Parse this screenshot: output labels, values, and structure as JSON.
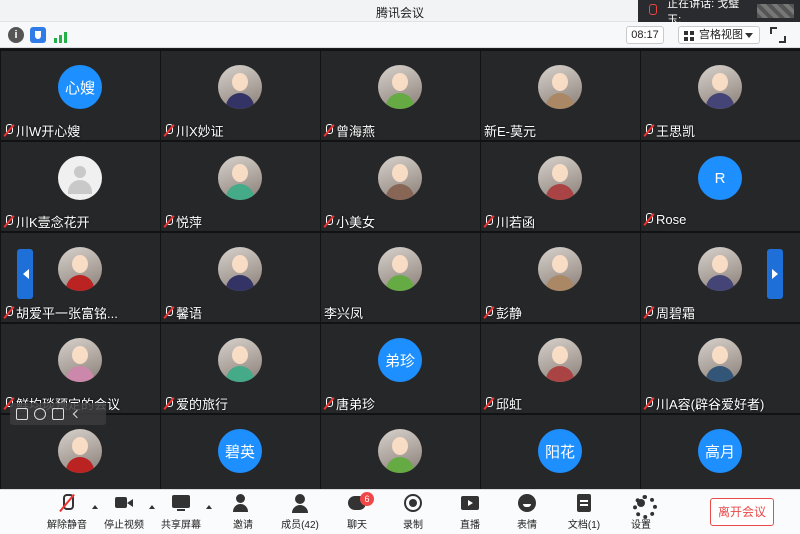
{
  "window": {
    "title": "腾讯会议",
    "speaking_label": "正在讲话: 戈璧玉;"
  },
  "infobar": {
    "time": "08:17",
    "view_label": "宫格视图"
  },
  "participants": [
    {
      "name": "川W开心嫂",
      "avatar_text": "心嫂",
      "muted": true
    },
    {
      "name": "川X妙证",
      "avatar_text": "",
      "muted": true
    },
    {
      "name": "曾海燕",
      "avatar_text": "",
      "muted": true
    },
    {
      "name": "新E-莫元",
      "avatar_text": "",
      "muted": false
    },
    {
      "name": "王思凯",
      "avatar_text": "",
      "muted": true
    },
    {
      "name": "川K壹念花开",
      "avatar_text": "",
      "muted": true
    },
    {
      "name": "悦萍",
      "avatar_text": "",
      "muted": true
    },
    {
      "name": "小美女",
      "avatar_text": "",
      "muted": true
    },
    {
      "name": "川若函",
      "avatar_text": "",
      "muted": true
    },
    {
      "name": "Rose",
      "avatar_text": "R",
      "muted": true
    },
    {
      "name": "胡爱平一张富铭...",
      "avatar_text": "",
      "muted": true
    },
    {
      "name": "馨语",
      "avatar_text": "",
      "muted": true
    },
    {
      "name": "李兴凤",
      "avatar_text": "",
      "muted": false
    },
    {
      "name": "彭静",
      "avatar_text": "",
      "muted": true
    },
    {
      "name": "周碧霜",
      "avatar_text": "",
      "muted": true
    },
    {
      "name": "鲜均琰预定的会议",
      "avatar_text": "",
      "muted": true
    },
    {
      "name": "爱的旅行",
      "avatar_text": "",
      "muted": true
    },
    {
      "name": "唐弟珍",
      "avatar_text": "弟珍",
      "muted": true
    },
    {
      "name": "邱虹",
      "avatar_text": "",
      "muted": true
    },
    {
      "name": "川A容(辟谷爱好者)",
      "avatar_text": "",
      "muted": true
    },
    {
      "name": "",
      "avatar_text": "",
      "muted": false
    },
    {
      "name": "",
      "avatar_text": "碧英",
      "muted": false
    },
    {
      "name": "",
      "avatar_text": "",
      "muted": false
    },
    {
      "name": "",
      "avatar_text": "阳花",
      "muted": false
    },
    {
      "name": "",
      "avatar_text": "高月",
      "muted": false
    }
  ],
  "toolbar": {
    "unmute": "解除静音",
    "stop_video": "停止视频",
    "share_screen": "共享屏幕",
    "invite": "邀请",
    "members": "成员(42)",
    "chat": "聊天",
    "chat_badge": "6",
    "record": "录制",
    "live": "直播",
    "emoji": "表情",
    "docs": "文档(1)",
    "settings": "设置",
    "leave": "离开会议"
  }
}
